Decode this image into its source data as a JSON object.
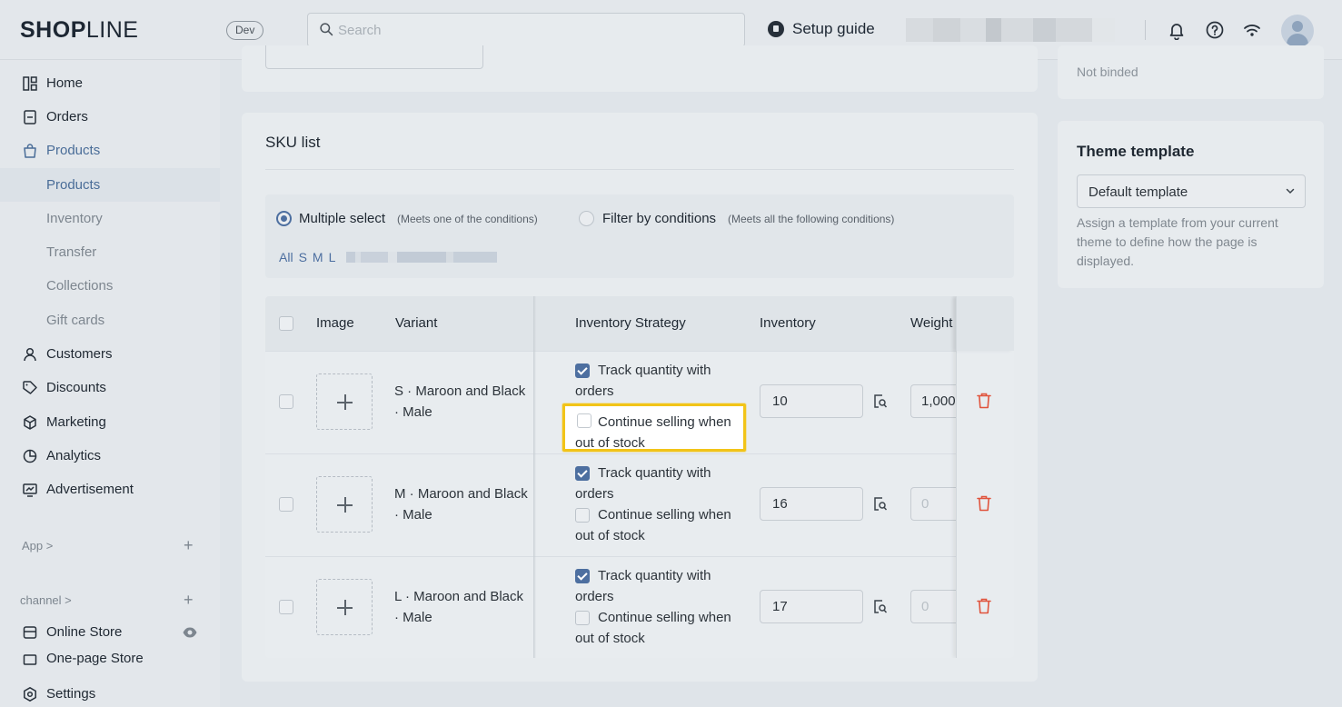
{
  "topbar": {
    "logo_main": "SH",
    "logo_o": "O",
    "logo_p": "P",
    "logo_thin": "LINE",
    "env_badge": "Dev",
    "search_placeholder": "Search",
    "setup_guide": "Setup guide"
  },
  "sidebar": {
    "items": [
      {
        "label": "Home",
        "icon": "home-icon"
      },
      {
        "label": "Orders",
        "icon": "orders-icon"
      },
      {
        "label": "Products",
        "icon": "bag-icon"
      },
      {
        "label": "Customers",
        "icon": "user-icon"
      },
      {
        "label": "Discounts",
        "icon": "tag-icon"
      },
      {
        "label": "Marketing",
        "icon": "cube-icon"
      },
      {
        "label": "Analytics",
        "icon": "pie-icon"
      },
      {
        "label": "Advertisement",
        "icon": "ad-icon"
      }
    ],
    "product_sub": [
      "Products",
      "Inventory",
      "Transfer",
      "Collections",
      "Gift cards"
    ],
    "app_group": "App >",
    "channel_group": "channel >",
    "channels": [
      "Online Store",
      "One-page Store"
    ],
    "settings": "Settings"
  },
  "sku": {
    "title": "SKU list",
    "option_multi": "Multiple select",
    "option_multi_hint": "(Meets one of the conditions)",
    "option_filter": "Filter by conditions",
    "option_filter_hint": "(Meets all the following conditions)",
    "tags": [
      "All",
      "S",
      "M",
      "L"
    ],
    "columns": [
      "Image",
      "Variant",
      "Inventory Strategy",
      "Inventory",
      "Weight"
    ],
    "track_label": "Track quantity with orders",
    "continue_label": "Continue selling when out of stock",
    "rows": [
      {
        "variant": "S · Maroon and Black · Male",
        "inventory": "10",
        "weight": "1,000",
        "weight_placeholder": false
      },
      {
        "variant": "M · Maroon and Black · Male",
        "inventory": "16",
        "weight": "0",
        "weight_placeholder": true
      },
      {
        "variant": "L · Maroon and Black · Male",
        "inventory": "17",
        "weight": "0",
        "weight_placeholder": true
      }
    ]
  },
  "right": {
    "binding_status": "Not binded",
    "theme_title": "Theme template",
    "theme_value": "Default template",
    "theme_desc": "Assign a template from your current theme to define how the page is displayed."
  },
  "colors": {
    "accent": "#4d6fa0",
    "highlight": "#f2c418",
    "danger": "#e0533c"
  }
}
